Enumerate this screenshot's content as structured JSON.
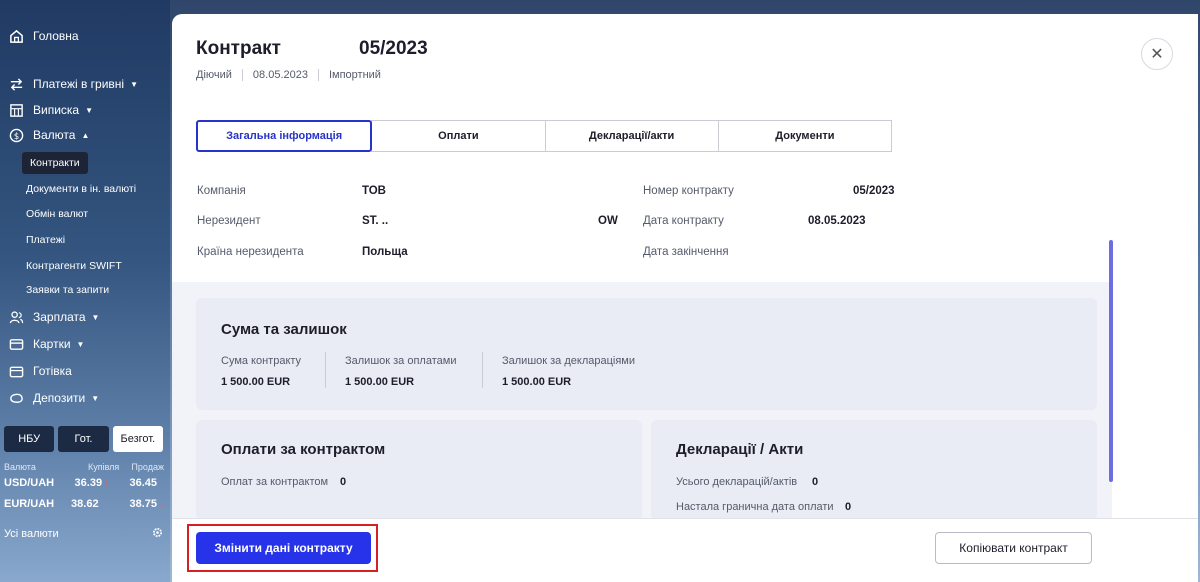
{
  "sidebar": {
    "nav": [
      {
        "label": "Головна",
        "icon": "home-icon"
      },
      {
        "label": "Платежі в гривні",
        "icon": "transfer-icon"
      },
      {
        "label": "Виписка",
        "icon": "statement-icon"
      },
      {
        "label": "Валюта",
        "icon": "currency-icon"
      },
      {
        "label": "Зарплата",
        "icon": "people-icon"
      },
      {
        "label": "Картки",
        "icon": "card-icon"
      },
      {
        "label": "Готівка",
        "icon": "wallet-icon"
      },
      {
        "label": "Депозити",
        "icon": "piggy-icon"
      }
    ],
    "currency_sub": [
      {
        "label": "Контракти",
        "active": true
      },
      {
        "label": "Документи в ін. валюті"
      },
      {
        "label": "Обмін валют"
      },
      {
        "label": "Платежі"
      },
      {
        "label": "Контрагенти SWIFT"
      },
      {
        "label": "Заявки та запити"
      }
    ],
    "rate_tabs": [
      "НБУ",
      "Гот.",
      "Безгот."
    ],
    "rates_header": {
      "currency": "Валюта",
      "buy": "Купівля",
      "sell": "Продаж"
    },
    "rates": [
      {
        "pair": "USD/UAH",
        "buy": "36.39",
        "sell": "36.45",
        "buy_down": true,
        "sell_down": true
      },
      {
        "pair": "EUR/UAH",
        "buy": "38.62",
        "sell": "38.75",
        "buy_down": false,
        "sell_down": true
      }
    ],
    "all_currencies": "Усі валюти"
  },
  "contract": {
    "title": "Контракт",
    "number": "05/2023",
    "status": "Діючий",
    "date": "08.05.2023",
    "type": "Імпортний"
  },
  "tabs": [
    "Загальна інформація",
    "Оплати",
    "Декларації/акти",
    "Документи"
  ],
  "info": {
    "company_label": "Компанія",
    "company_value": "ТОВ",
    "nonresident_label": "Нерезидент",
    "nonresident_value": "ST. ..",
    "nonresident_suffix": "OW",
    "country_label": "Країна нерезидента",
    "country_value": "Польща",
    "number_label": "Номер контракту",
    "number_value": "05/2023",
    "date_label": "Дата контракту",
    "date_value": "08.05.2023",
    "end_label": "Дата закінчення"
  },
  "sum_card": {
    "title": "Сума та залишок",
    "items": [
      {
        "label": "Сума контракту",
        "value": "1 500.00 EUR"
      },
      {
        "label": "Залишок за оплатами",
        "value": "1 500.00 EUR"
      },
      {
        "label": "Залишок за деклараціями",
        "value": "1 500.00 EUR"
      }
    ]
  },
  "payments_card": {
    "title": "Оплати за контрактом",
    "label": "Оплат за контрактом",
    "value": "0"
  },
  "declarations_card": {
    "title": "Декларації / Акти",
    "total_label": "Усього декларацій/актів",
    "total_value": "0",
    "due_label": "Настала гранична дата оплати",
    "due_value": "0"
  },
  "footer": {
    "primary": "Змінити дані контракту",
    "secondary": "Копіювати контракт"
  },
  "colors": {
    "accent": "#2733e8",
    "highlight": "#d42020",
    "sidebar": "#345680"
  }
}
